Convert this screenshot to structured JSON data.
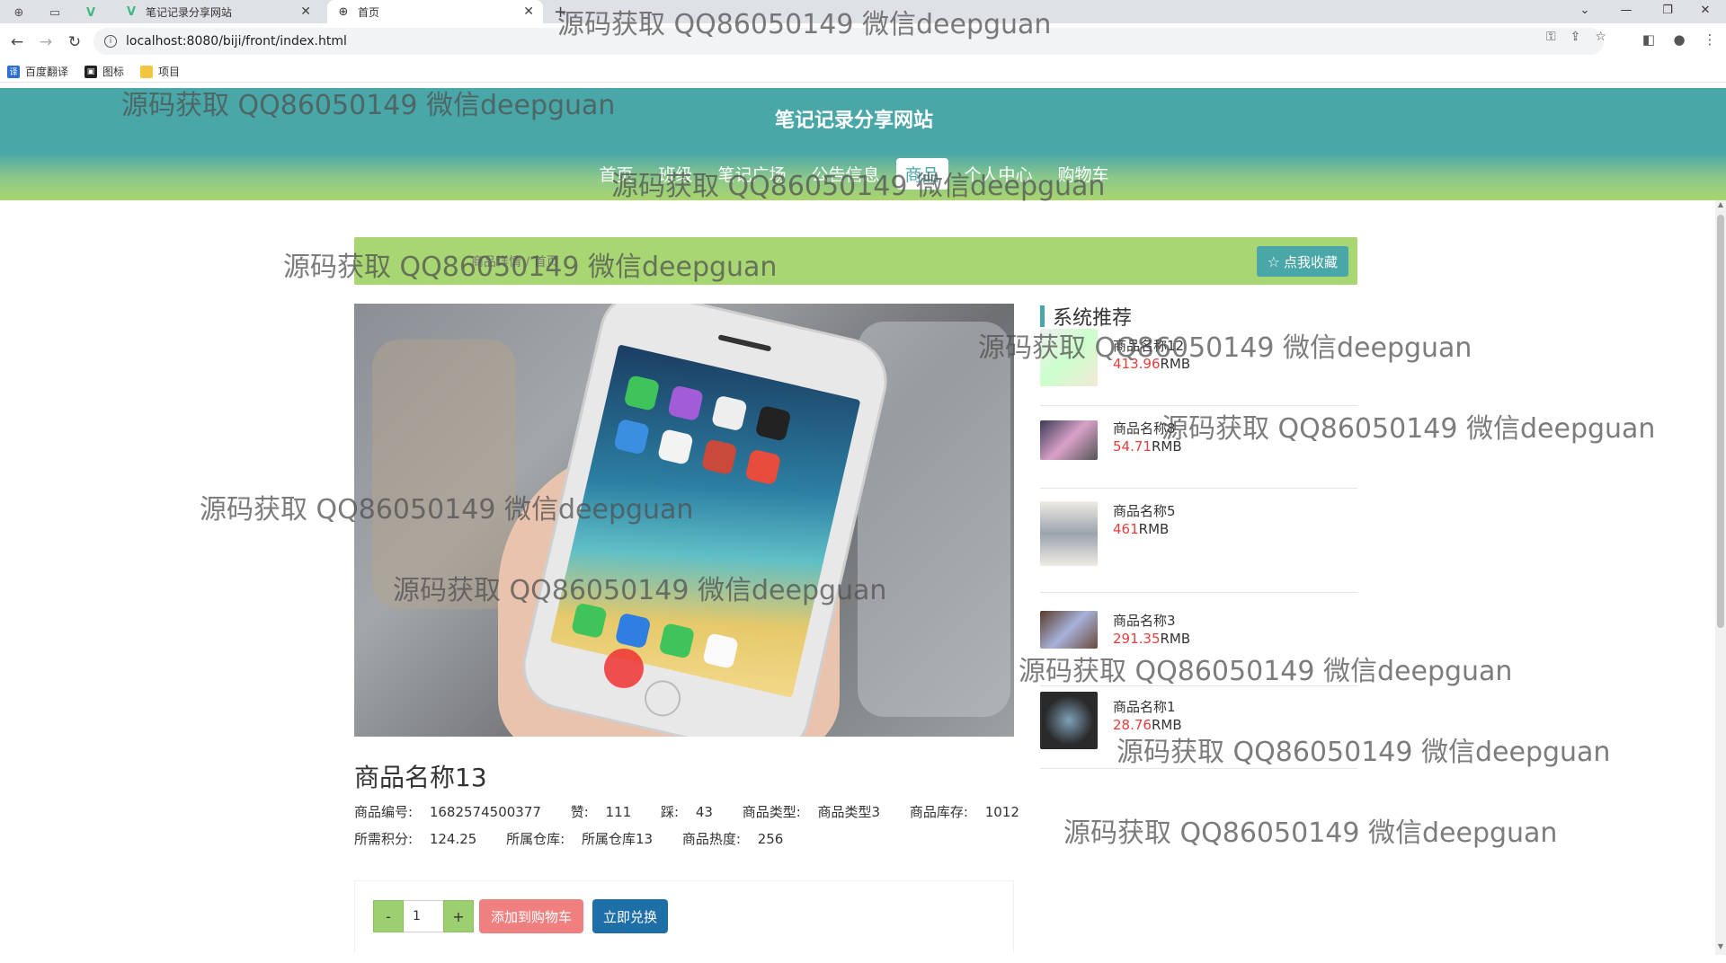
{
  "browser": {
    "tabs": [
      {
        "title": "笔记记录分享网站",
        "icon": "vue-logo-icon"
      },
      {
        "title": "首页",
        "icon": "globe-icon"
      }
    ],
    "new_tab": "+",
    "url": "localhost:8080/biji/front/index.html",
    "bookmarks": [
      {
        "label": "百度翻译",
        "icon": "baidu-translate-icon"
      },
      {
        "label": "图标",
        "icon": "image-icon"
      },
      {
        "label": "项目",
        "icon": "folder-icon"
      }
    ]
  },
  "site": {
    "title": "笔记记录分享网站",
    "nav": [
      {
        "label": "首页"
      },
      {
        "label": "班级"
      },
      {
        "label": "笔记广场"
      },
      {
        "label": "公告信息"
      },
      {
        "label": "商品"
      },
      {
        "label": "个人中心"
      },
      {
        "label": "购物车"
      }
    ],
    "active_nav": "商品"
  },
  "breadcrumb": {
    "text": "商品详情 / 首页"
  },
  "favorite_button": "点我收藏",
  "recommend": {
    "heading": "系统推荐",
    "items": [
      {
        "name": "商品名称12",
        "price": "413.96",
        "unit": "RMB"
      },
      {
        "name": "商品名称8",
        "price": "54.71",
        "unit": "RMB"
      },
      {
        "name": "商品名称5",
        "price": "461",
        "unit": "RMB"
      },
      {
        "name": "商品名称3",
        "price": "291.35",
        "unit": "RMB"
      },
      {
        "name": "商品名称1",
        "price": "28.76",
        "unit": "RMB"
      }
    ]
  },
  "product": {
    "name": "商品名称13",
    "meta_row1": [
      {
        "label": "商品编号:",
        "value": "1682574500377"
      },
      {
        "label": "赞:",
        "value": "111"
      },
      {
        "label": "踩:",
        "value": "43"
      },
      {
        "label": "商品类型:",
        "value": "商品类型3"
      },
      {
        "label": "商品库存:",
        "value": "1012"
      }
    ],
    "meta_row2": [
      {
        "label": "所需积分:",
        "value": "124.25"
      },
      {
        "label": "所属仓库:",
        "value": "所属仓库13"
      },
      {
        "label": "商品热度:",
        "value": "256"
      }
    ]
  },
  "cart": {
    "minus": "-",
    "quantity": "1",
    "plus": "+",
    "add_to_cart": "添加到购物车",
    "buy_now": "立即兑换"
  },
  "watermark": "源码获取 QQ86050149 微信deepguan",
  "colors": {
    "header_teal": "#4aa7a8",
    "header_green": "#a9d56e",
    "price_red": "#e53e3e",
    "add_cart_pink": "#f08080",
    "buy_blue": "#1e6fa8"
  }
}
